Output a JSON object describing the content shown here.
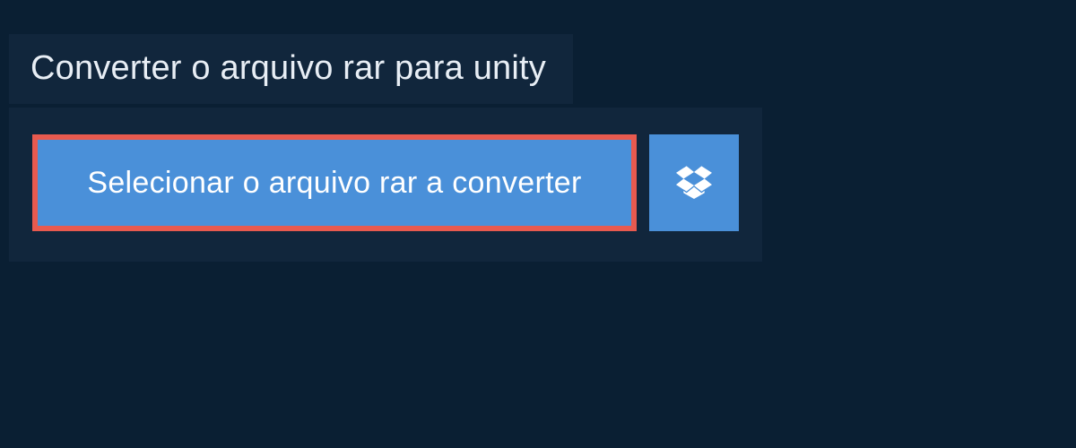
{
  "title": "Converter o arquivo rar para unity",
  "select_button_label": "Selecionar o arquivo rar a converter",
  "dropbox_icon_name": "dropbox-icon",
  "colors": {
    "page_bg": "#0a1f33",
    "panel_bg": "#11263c",
    "button_bg": "#4a90d9",
    "highlight_border": "#e85a4f",
    "text_light": "#e8eef5",
    "text_white": "#ffffff"
  }
}
